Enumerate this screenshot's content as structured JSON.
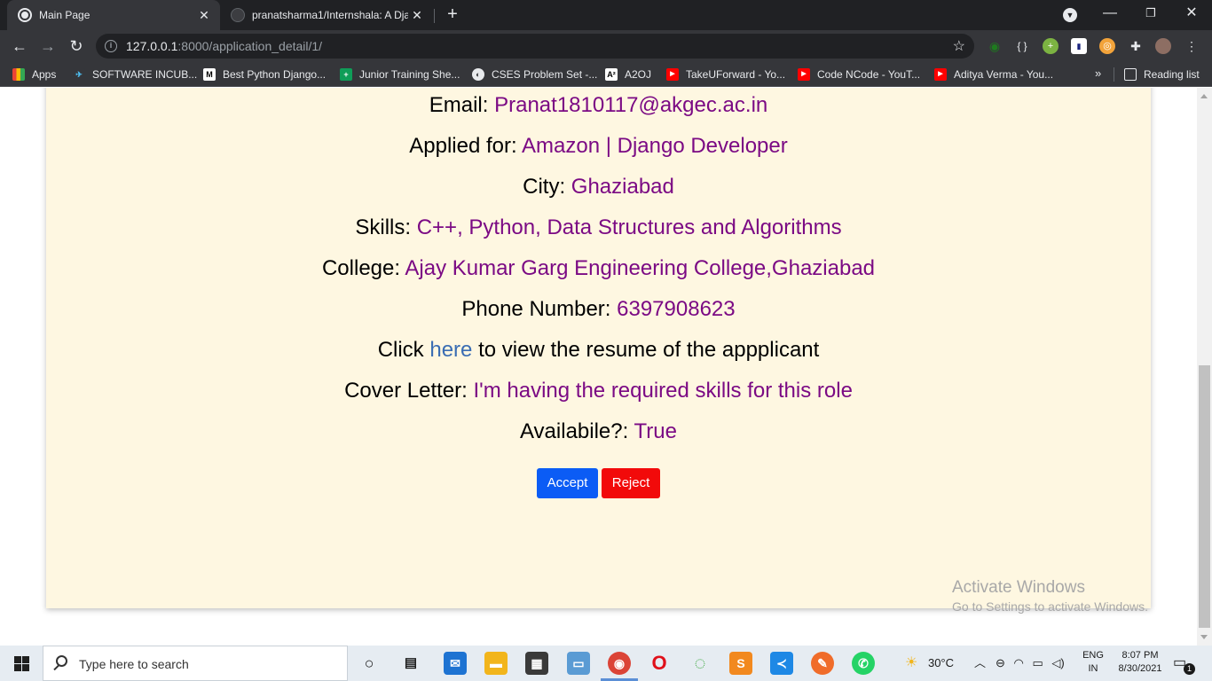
{
  "browser": {
    "tabs": [
      {
        "title": "Main Page",
        "active": true
      },
      {
        "title": "pranatsharma1/Internshala: A Dja",
        "active": false
      }
    ],
    "address": {
      "host": "127.0.0.1",
      "path": ":8000/application_detail/1/"
    },
    "bookmarks": [
      {
        "label": "Apps",
        "icon": "apps-grid-icon"
      },
      {
        "label": "SOFTWARE INCUB...",
        "icon": "software-incubator-icon"
      },
      {
        "label": "Best Python Django...",
        "icon": "medium-icon"
      },
      {
        "label": "Junior Training She...",
        "icon": "sheets-icon"
      },
      {
        "label": "CSES Problem Set -...",
        "icon": "cses-icon"
      },
      {
        "label": "A2OJ",
        "icon": "a2oj-icon"
      },
      {
        "label": "TakeUForward - Yo...",
        "icon": "youtube-icon"
      },
      {
        "label": "Code NCode - YouT...",
        "icon": "youtube-icon"
      },
      {
        "label": "Aditya Verma - You...",
        "icon": "youtube-icon"
      }
    ],
    "bookmarks_more": "»",
    "reading_list": "Reading list"
  },
  "application": {
    "email": {
      "label": "Email:",
      "value": "Pranat1810117@akgec.ac.in"
    },
    "applied_for": {
      "label": "Applied for:",
      "value": "Amazon | Django Developer"
    },
    "city": {
      "label": "City:",
      "value": "Ghaziabad"
    },
    "skills": {
      "label": "Skills:",
      "value": "C++, Python, Data Structures and Algorithms"
    },
    "college": {
      "label": "College:",
      "value": "Ajay Kumar Garg Engineering College,Ghaziabad"
    },
    "phone": {
      "label": "Phone Number:",
      "value": "6397908623"
    },
    "resume": {
      "prefix": "Click",
      "link": "here",
      "suffix": "to view the resume of the appplicant"
    },
    "cover_letter": {
      "label": "Cover Letter:",
      "value": "I'm having the required skills for this role"
    },
    "available": {
      "label": "Availabile?:",
      "value": "True"
    },
    "accept_label": "Accept",
    "reject_label": "Reject"
  },
  "watermark": {
    "line1": "Activate Windows",
    "line2": "Go to Settings to activate Windows."
  },
  "taskbar": {
    "search_placeholder": "Type here to search",
    "weather": "30°C",
    "language": "ENG",
    "region": "IN",
    "time": "8:07 PM",
    "date": "8/30/2021",
    "notification_count": "1"
  },
  "colors": {
    "card_background": "#fef7e1",
    "value_text": "#7b0a84",
    "link_text": "#3a6db3",
    "accept": "#0b5cf5",
    "reject": "#f20a0a"
  }
}
